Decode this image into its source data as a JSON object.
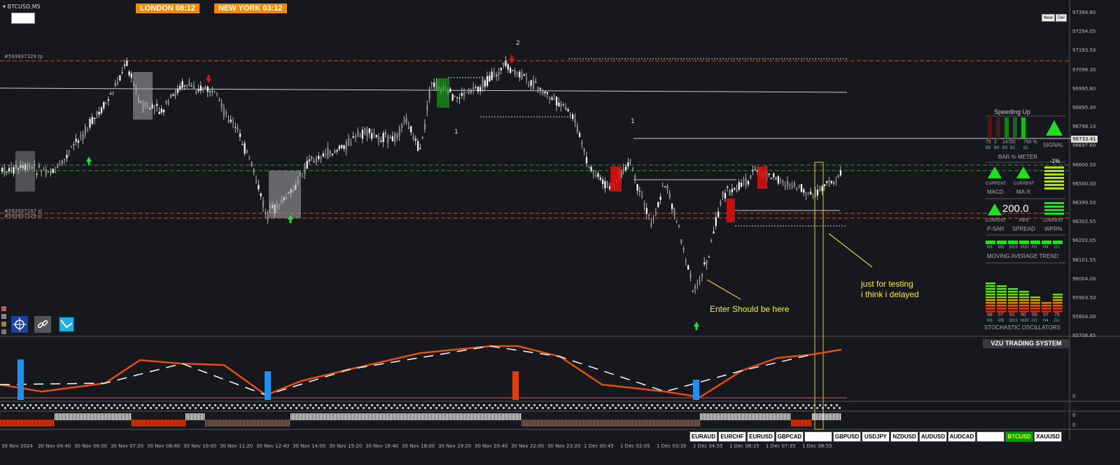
{
  "window": {
    "symbol": "BTCUSD,M5"
  },
  "sessions": {
    "london": "LONDON   08:12",
    "newyork": "NEW YORK  03:12"
  },
  "buttons": {
    "new": "New",
    "del": "Del"
  },
  "trade_labels": {
    "tp_top": "#593937329 tp",
    "sl_a": "#593937187 sl",
    "sl_b": "#593937329 sl"
  },
  "chart_markers": {
    "wave2": "2",
    "wave1a": "1",
    "wave1b": "1"
  },
  "price_axis": [
    "97394.60",
    "97294.05",
    "97193.50",
    "97096.30",
    "96995.80",
    "96895.30",
    "96798.10",
    "96697.60",
    "96600.50",
    "96500.00",
    "96399.50",
    "96302.55",
    "96202.05",
    "96101.55",
    "96004.00",
    "95903.50",
    "95804.00",
    "95706.65"
  ],
  "current_price": "96733.41",
  "time_axis": [
    "30 Nov 2024",
    "30 Nov 04:40",
    "30 Nov 06:00",
    "30 Nov 07:20",
    "30 Nov 08:40",
    "30 Nov 10:00",
    "30 Nov 11:20",
    "30 Nov 12:40",
    "30 Nov 14:00",
    "30 Nov 15:20",
    "30 Nov 16:40",
    "30 Nov 18:00",
    "30 Nov 19:20",
    "30 Nov 20:40",
    "30 Nov 22:00",
    "30 Nov 23:20",
    "1 Dec 00:45",
    "1 Dec 02:05",
    "1 Dec 03:35",
    "1 Dec 04:55",
    "1 Dec 06:15",
    "1 Dec 07:35",
    "1 Dec 08:55"
  ],
  "annotations": {
    "enter": "Enter Should be here",
    "testing_line1": "just for testing",
    "testing_line2": "i think i delayed"
  },
  "dashboard": {
    "title": "Speeding Up",
    "bar_meter": {
      "values": [
        "75",
        "2",
        "147",
        "20",
        "750 %"
      ],
      "labels": [
        "B5",
        "B4",
        "B3",
        "B2",
        "B1"
      ],
      "caption": "BAR % METER",
      "signal": "SIGNAL"
    },
    "macd": {
      "tf": "CURRENT",
      "label": "MACD"
    },
    "max": {
      "tf": "CURRENT",
      "label": "MA-X"
    },
    "percent": "-1%",
    "psar": {
      "tf": "CURRENT",
      "label": "P-SAR"
    },
    "spread": {
      "value": "200.0",
      "tf": "PIPS",
      "label": "SPREAD"
    },
    "wpr": {
      "tf": "CURRENT",
      "label": "WPR%"
    },
    "ma_trend": {
      "tfs": [
        "M1",
        "M5",
        "M15",
        "M30",
        "H1",
        "H4",
        "D1"
      ],
      "caption": "MOVING AVERAGE TREND"
    },
    "stoch": {
      "values": [
        "98",
        "97",
        "91",
        "90",
        "59",
        "37",
        "75"
      ],
      "tfs": [
        "M1",
        "M5",
        "M15",
        "M30",
        "H1",
        "H4",
        "D1"
      ],
      "caption": "STOCHASTIC OSCILLATORS"
    }
  },
  "indicator": {
    "title": "VZU TRADING SYSTEM",
    "zero1": "0",
    "zero2": "0",
    "zero3": "0"
  },
  "symbol_tabs": [
    "EURAUD",
    "EURCHF",
    "EURUSD",
    "GBPCAD",
    "",
    "GBPUSD",
    "USDJPY",
    "NZDUSD",
    "AUDUSD",
    "AUDCAD",
    "",
    "BTCUSD",
    "XAUUSD"
  ],
  "active_tab": "BTCUSD",
  "colors": {
    "bg": "#16181d",
    "session": "#f08c00",
    "active_tab": "#00a000",
    "annotation": "#ffeb3b"
  },
  "icons": [
    "crosshair-icon",
    "link-icon",
    "chart-icon"
  ]
}
